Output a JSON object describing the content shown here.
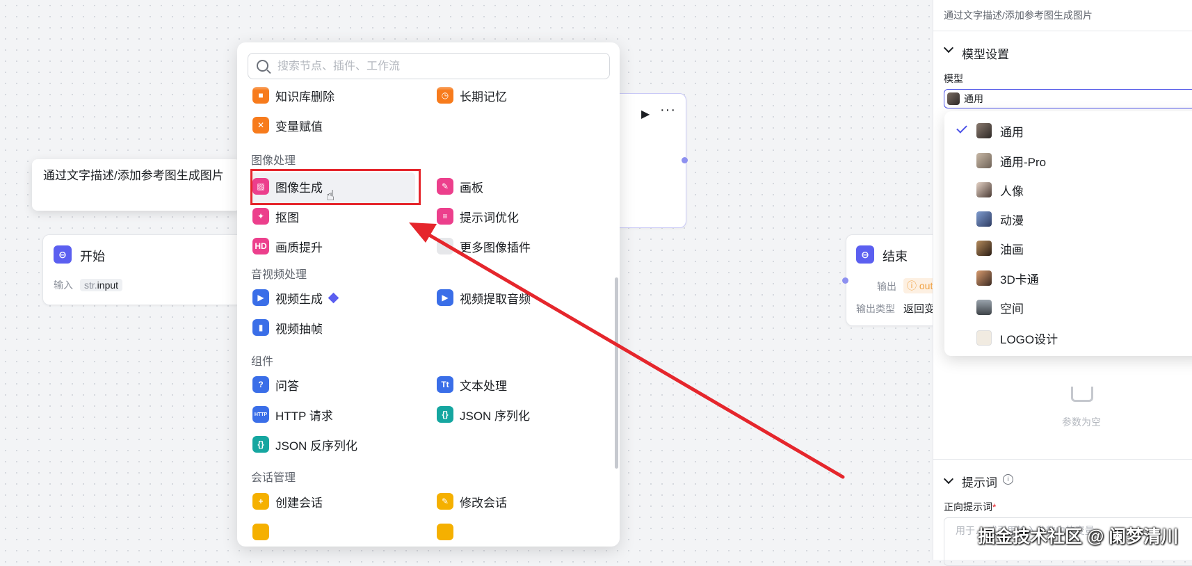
{
  "tooltip": {
    "text": "通过文字描述/添加参考图生成图片"
  },
  "start_node": {
    "title": "开始",
    "input_label": "输入",
    "var_type": "str.",
    "var_name": "input"
  },
  "end_node": {
    "title": "结束",
    "output_label": "输出",
    "output_value": "out",
    "output_type_label": "输出类型",
    "output_type_value": "返回变"
  },
  "search": {
    "placeholder": "搜索节点、插件、工作流"
  },
  "panel": {
    "top_items": [
      {
        "label": "知识库删除",
        "icon": "knowledge-delete-icon"
      },
      {
        "label": "长期记忆",
        "icon": "long-term-memory-icon"
      },
      {
        "label": "变量赋值",
        "icon": "variable-assign-icon"
      }
    ],
    "sections": {
      "image": "图像处理",
      "audio_video": "音视频处理",
      "components": "组件",
      "session": "会话管理"
    },
    "image_items": [
      {
        "label": "图像生成",
        "icon": "image-generate-icon"
      },
      {
        "label": "画板",
        "icon": "canvas-icon"
      },
      {
        "label": "抠图",
        "icon": "cutout-icon"
      },
      {
        "label": "提示词优化",
        "icon": "prompt-optimize-icon"
      },
      {
        "label": "画质提升",
        "icon": "hd-icon"
      },
      {
        "label": "更多图像插件",
        "icon": "more-plugins-icon"
      }
    ],
    "av_items": [
      {
        "label": "视频生成",
        "icon": "video-generate-icon"
      },
      {
        "label": "视频提取音频",
        "icon": "video-audio-icon"
      },
      {
        "label": "视频抽帧",
        "icon": "video-frame-icon"
      }
    ],
    "component_items": [
      {
        "label": "问答",
        "icon": "qa-icon"
      },
      {
        "label": "文本处理",
        "icon": "text-process-icon"
      },
      {
        "label": "HTTP 请求",
        "icon": "http-icon"
      },
      {
        "label": "JSON 序列化",
        "icon": "json-serialize-icon"
      },
      {
        "label": "JSON 反序列化",
        "icon": "json-deserialize-icon"
      }
    ],
    "session_items": [
      {
        "label": "创建会话",
        "icon": "create-session-icon"
      },
      {
        "label": "修改会话",
        "icon": "edit-session-icon"
      }
    ]
  },
  "right_panel": {
    "description": "通过文字描述/添加参考图生成图片",
    "model_section": "模型设置",
    "model_label": "模型",
    "model_selected": "通用",
    "model_options": [
      "通用",
      "通用-Pro",
      "人像",
      "动漫",
      "油画",
      "3D卡通",
      "空间",
      "LOGO设计"
    ],
    "empty_text": "参数为空",
    "prompt_section": "提示词",
    "positive_prompt_label": "正向提示词",
    "prompt_placeholder": "用于… 式引用输入参数中的变量"
  },
  "watermark": "掘金技术社区 @ 阑梦清川",
  "colors": {
    "accent": "#4d53e8",
    "annotation_red": "#e5262c"
  }
}
